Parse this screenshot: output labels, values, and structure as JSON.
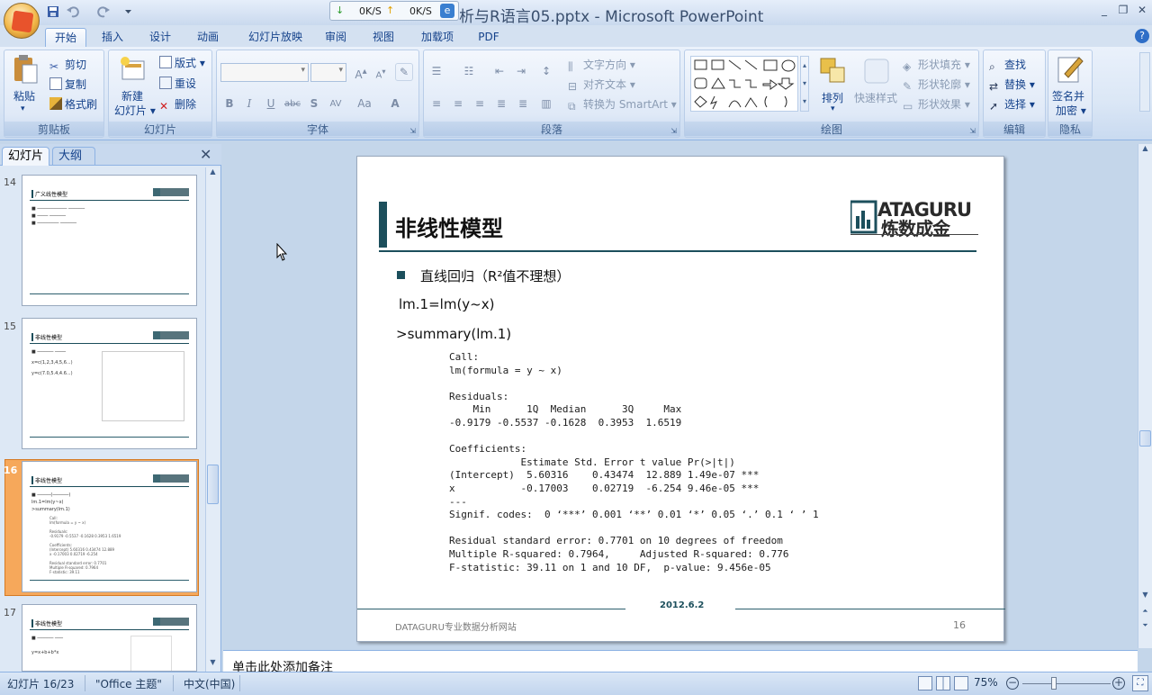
{
  "window": {
    "title": "析与R语言05.pptx - Microsoft PowerPoint",
    "net_down": "0K/S",
    "net_up": "0K/S"
  },
  "tabs": [
    "开始",
    "插入",
    "设计",
    "动画",
    "幻灯片放映",
    "审阅",
    "视图",
    "加载项",
    "PDF"
  ],
  "ribbon": {
    "clipboard": {
      "paste": "粘贴",
      "cut": "剪切",
      "copy": "复制",
      "format_painter": "格式刷",
      "label": "剪贴板"
    },
    "slides": {
      "new_slide": "新建",
      "new_slide2": "幻灯片",
      "layout": "版式",
      "reset": "重设",
      "delete": "删除",
      "label": "幻灯片"
    },
    "font": {
      "label": "字体"
    },
    "paragraph": {
      "text_direction": "文字方向",
      "align_text": "对齐文本",
      "smartart": "转换为 SmartArt",
      "label": "段落"
    },
    "drawing": {
      "arrange": "排列",
      "quick_styles": "快速样式",
      "shape_fill": "形状填充",
      "shape_outline": "形状轮廓",
      "shape_effects": "形状效果",
      "label": "绘图"
    },
    "editing": {
      "find": "查找",
      "replace": "替换",
      "select": "选择",
      "label": "编辑"
    },
    "privacy": {
      "sign": "签名并",
      "encrypt": "加密",
      "label": "隐私"
    }
  },
  "panel": {
    "tab_slides": "幻灯片",
    "tab_outline": "大纲",
    "thumbs": [
      {
        "num": "14",
        "title": "广义线性模型"
      },
      {
        "num": "15",
        "title": "非线性模型"
      },
      {
        "num": "16",
        "title": "非线性模型"
      },
      {
        "num": "17",
        "title": "非线性模型"
      }
    ]
  },
  "slide": {
    "title": "非线性模型",
    "bullet": "直线回归（R²值不理想）",
    "line1": "lm.1=lm(y~x)",
    "line2": ">summary(lm.1)",
    "code": "Call:\nlm(formula = y ~ x)\n\nResiduals:\n    Min      1Q  Median      3Q     Max\n-0.9179 -0.5537 -0.1628  0.3953  1.6519\n\nCoefficients:\n            Estimate Std. Error t value Pr(>|t|)\n(Intercept)  5.60316    0.43474  12.889 1.49e-07 ***\nx           -0.17003    0.02719  -6.254 9.46e-05 ***\n---\nSignif. codes:  0 ‘***’ 0.001 ‘**’ 0.01 ‘*’ 0.05 ‘.’ 0.1 ‘ ’ 1\n\nResidual standard error: 0.7701 on 10 degrees of freedom\nMultiple R-squared: 0.7964,     Adjusted R-squared: 0.776\nF-statistic: 39.11 on 1 and 10 DF,  p-value: 9.456e-05",
    "date": "2012.6.2",
    "footer": "DATAGURU专业数据分析网站",
    "number": "16",
    "logo_text": "ATAGURU",
    "logo_sub": "炼数成金"
  },
  "notes": "单击此处添加备注",
  "status": {
    "slide_pos": "幻灯片 16/23",
    "theme": "\"Office 主题\"",
    "lang": "中文(中国)",
    "zoom": "75%"
  }
}
